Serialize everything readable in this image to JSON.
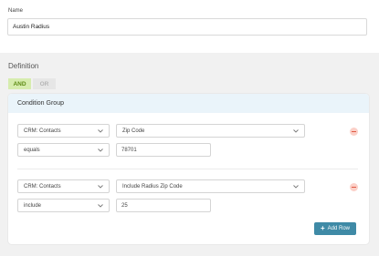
{
  "name_field": {
    "label": "Name",
    "value": "Austin Radius"
  },
  "definition": {
    "title": "Definition",
    "and_label": "AND",
    "or_label": "OR"
  },
  "condition_group": {
    "title": "Condition Group",
    "conditions": [
      {
        "source": "CRM: Contacts",
        "field": "Zip Code",
        "operator": "equals",
        "value": "78701"
      },
      {
        "source": "CRM: Contacts",
        "field": "Include Radius Zip Code",
        "operator": "include",
        "value": "25"
      }
    ],
    "add_row_label": "Add Row"
  },
  "icons": {
    "dropdown": "chevron-down-icon",
    "remove": "remove-icon",
    "add": "plus-icon"
  },
  "colors": {
    "and_active_bg": "#d6ecae",
    "and_active_text": "#5e8c16",
    "group_header_bg": "#eaf4fa",
    "add_button_bg": "#3f8aa6",
    "remove_icon": "#e05a44"
  }
}
